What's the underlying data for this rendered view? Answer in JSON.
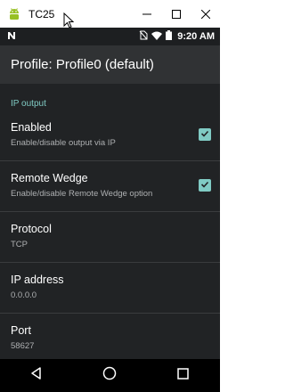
{
  "window": {
    "title": "TC25",
    "icons": {
      "app": "android-icon",
      "minimize": "minimize-icon",
      "maximize": "maximize-icon",
      "close": "close-icon"
    }
  },
  "status_bar": {
    "time": "9:20 AM",
    "icons": [
      "n-notification-icon",
      "no-sim-icon",
      "wifi-icon",
      "battery-icon"
    ]
  },
  "app_bar": {
    "title": "Profile: Profile0 (default)"
  },
  "section": {
    "header": "IP output"
  },
  "preferences": [
    {
      "title": "Enabled",
      "summary": "Enable/disable output via IP",
      "checked": true
    },
    {
      "title": "Remote Wedge",
      "summary": "Enable/disable Remote Wedge option",
      "checked": true
    },
    {
      "title": "Protocol",
      "summary": "TCP"
    },
    {
      "title": "IP address",
      "summary": "0.0.0.0"
    },
    {
      "title": "Port",
      "summary": "58627"
    }
  ],
  "nav_bar": {
    "icons": [
      "back-icon",
      "home-icon",
      "recents-icon"
    ]
  },
  "colors": {
    "accent": "#80cbc4",
    "app_bar": "#303234",
    "background": "#212325",
    "status_bar": "#1d1f21",
    "nav_bar": "#000000"
  }
}
